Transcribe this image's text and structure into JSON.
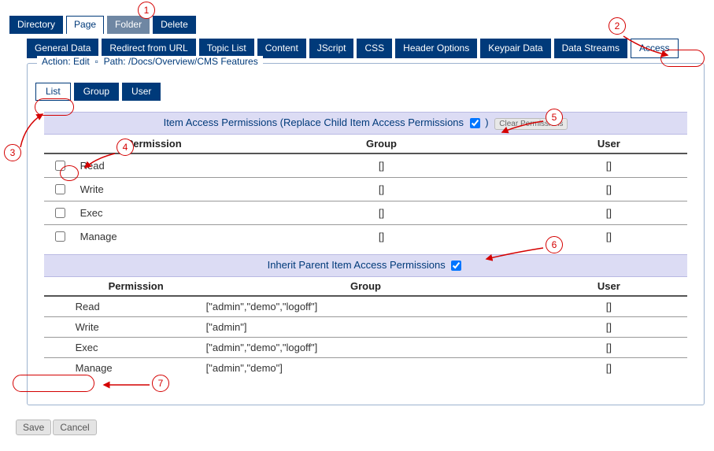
{
  "topTabs": {
    "directory": "Directory",
    "page": "Page",
    "folder": "Folder",
    "delete": "Delete"
  },
  "secondTabs": {
    "general": "General Data",
    "redirect": "Redirect from URL",
    "topic": "Topic List",
    "content": "Content",
    "jscript": "JScript",
    "css": "CSS",
    "header": "Header Options",
    "keypair": "Keypair Data",
    "streams": "Data Streams",
    "access": "Access"
  },
  "panel": {
    "action_label": "Action:",
    "action_value": "Edit",
    "path_label": "Path:",
    "path_value": "/Docs/Overview/CMS Features"
  },
  "innerTabs": {
    "list": "List",
    "group": "Group",
    "user": "User"
  },
  "headers": {
    "permission": "Permission",
    "group": "Group",
    "user": "User"
  },
  "table1": {
    "title": "Item Access Permissions (Replace Child Item Access Permissions",
    "title_end": ")",
    "clear": "Clear Permissions",
    "rows": [
      {
        "perm": "Read",
        "group": "[]",
        "user": "[]"
      },
      {
        "perm": "Write",
        "group": "[]",
        "user": "[]"
      },
      {
        "perm": "Exec",
        "group": "[]",
        "user": "[]"
      },
      {
        "perm": "Manage",
        "group": "[]",
        "user": "[]"
      }
    ]
  },
  "table2": {
    "title": "Inherit Parent Item Access Permissions",
    "rows": [
      {
        "perm": "Read",
        "group": "[\"admin\",\"demo\",\"logoff\"]",
        "user": "[]"
      },
      {
        "perm": "Write",
        "group": "[\"admin\"]",
        "user": "[]"
      },
      {
        "perm": "Exec",
        "group": "[\"admin\",\"demo\",\"logoff\"]",
        "user": "[]"
      },
      {
        "perm": "Manage",
        "group": "[\"admin\",\"demo\"]",
        "user": "[]"
      }
    ]
  },
  "buttons": {
    "save": "Save",
    "cancel": "Cancel"
  },
  "callouts": {
    "1": "1",
    "2": "2",
    "3": "3",
    "4": "4",
    "5": "5",
    "6": "6",
    "7": "7"
  }
}
